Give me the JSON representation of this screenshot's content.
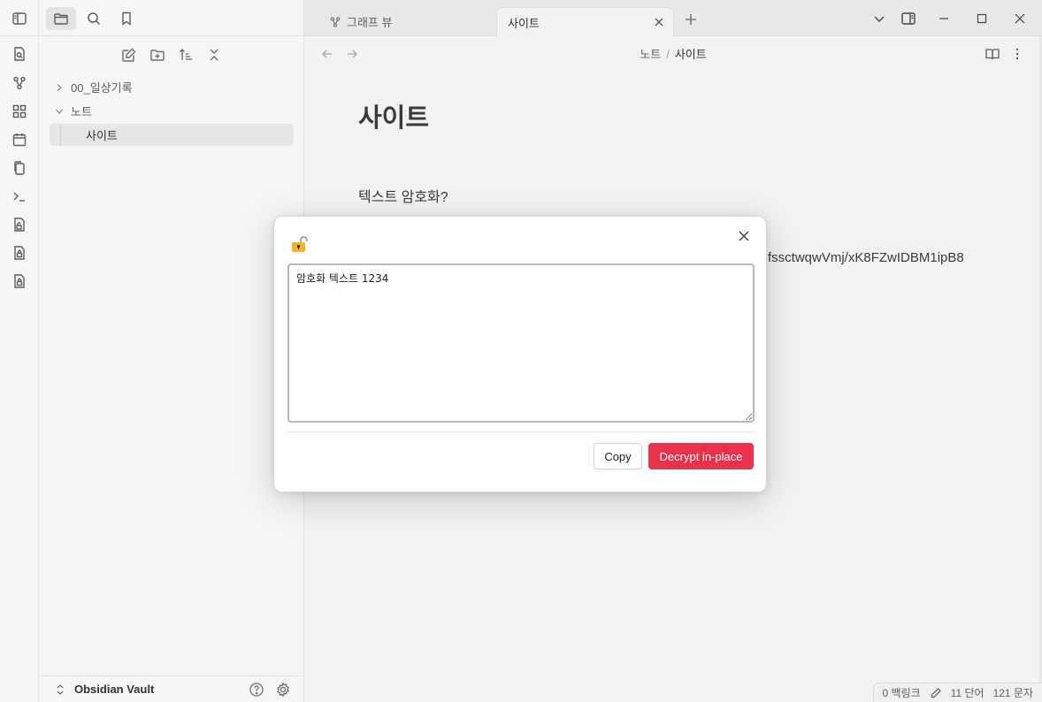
{
  "sidebar": {
    "tree": [
      {
        "label": "00_일상기록",
        "expanded": false
      },
      {
        "label": "노트",
        "expanded": true,
        "children": [
          {
            "label": "사이트"
          }
        ]
      }
    ],
    "vault_name": "Obsidian Vault"
  },
  "tabs": [
    {
      "label": "그래프 뷰",
      "icon": "graph-icon",
      "active": false
    },
    {
      "label": "사이트",
      "active": true
    }
  ],
  "breadcrumb": {
    "parent": "노트",
    "separator": "/",
    "current": "사이트"
  },
  "note": {
    "title": "사이트",
    "line1": "텍스트 암호화?",
    "cipher_fragment": "fssctwqwVmj/xK8FZwIDBM1ipB8"
  },
  "status": {
    "backlinks": "0 백링크",
    "words": "11 단어",
    "chars": "121 문자"
  },
  "modal": {
    "textarea_value": "암호화 텍스트 1234",
    "copy_label": "Copy",
    "decrypt_label": "Decrypt in-place"
  },
  "colors": {
    "accent": "#e93147",
    "lock": "#f0b429"
  }
}
